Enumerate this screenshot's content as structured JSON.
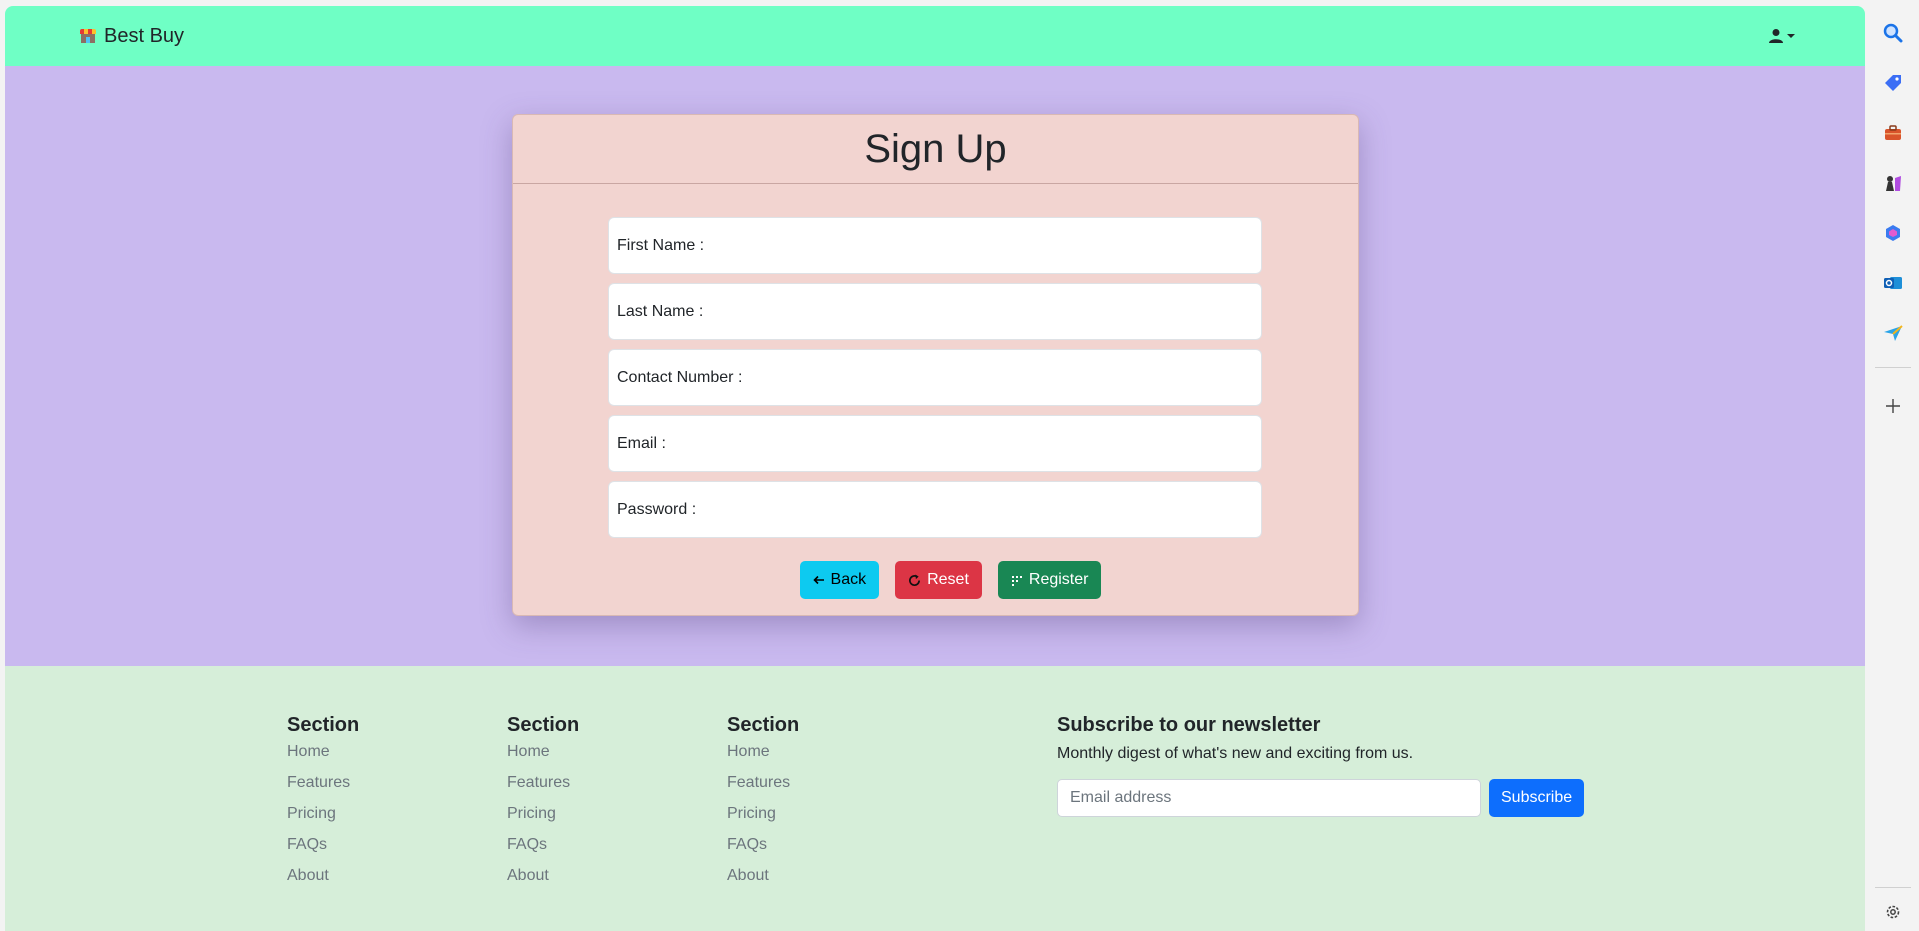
{
  "navbar": {
    "brand": "Best Buy",
    "user_menu_icon": "user-icon"
  },
  "signup": {
    "title": "Sign Up",
    "fields": [
      {
        "label": "First Name :"
      },
      {
        "label": "Last Name :"
      },
      {
        "label": "Contact Number :"
      },
      {
        "label": "Email :"
      },
      {
        "label": "Password :"
      }
    ],
    "buttons": {
      "back": "Back",
      "reset": "Reset",
      "register": "Register"
    }
  },
  "footer": {
    "columns": [
      {
        "title": "Section",
        "links": [
          "Home",
          "Features",
          "Pricing",
          "FAQs",
          "About"
        ]
      },
      {
        "title": "Section",
        "links": [
          "Home",
          "Features",
          "Pricing",
          "FAQs",
          "About"
        ]
      },
      {
        "title": "Section",
        "links": [
          "Home",
          "Features",
          "Pricing",
          "FAQs",
          "About"
        ]
      }
    ],
    "newsletter": {
      "title": "Subscribe to our newsletter",
      "description": "Monthly digest of what's new and exciting from us.",
      "placeholder": "Email address",
      "button": "Subscribe"
    }
  },
  "colors": {
    "navbar": "#6fffc5",
    "main_bg": "#c9b9ef",
    "card_bg": "#f2d4d0",
    "footer_bg": "#d6eed9",
    "back_btn": "#0dcaf0",
    "reset_btn": "#dc3545",
    "register_btn": "#198754",
    "subscribe_btn": "#0d6efd"
  },
  "browser_sidebar": {
    "icons": [
      "search-icon",
      "tag-icon",
      "briefcase-icon",
      "chess-icon",
      "copilot-icon",
      "outlook-icon",
      "send-icon",
      "add-icon",
      "settings-icon"
    ]
  }
}
